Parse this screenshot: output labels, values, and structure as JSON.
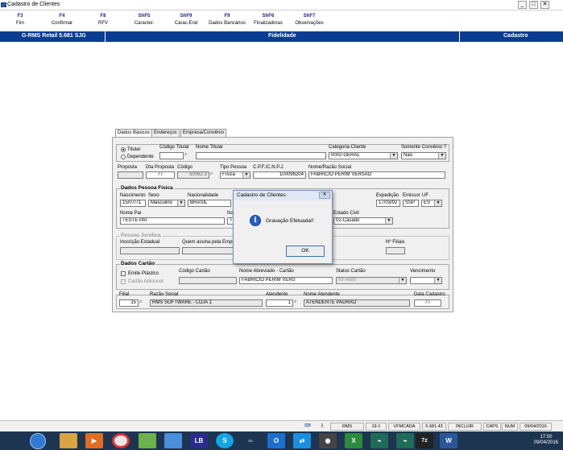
{
  "window": {
    "title": "Cadastro de Clientes",
    "minimize": "_",
    "maximize": "□",
    "close": "✕"
  },
  "function_keys": [
    {
      "key": "F3",
      "label": "Fim"
    },
    {
      "key": "F4",
      "label": "Confirmar"
    },
    {
      "key": "F8",
      "label": "RFV"
    },
    {
      "key": "ShF5",
      "label": "Caracter."
    },
    {
      "key": "ShF9",
      "label": "Carac.End"
    },
    {
      "key": "F9",
      "label": "Dados Bancários"
    },
    {
      "key": "ShF6",
      "label": "Finalizadoras"
    },
    {
      "key": "ShF7",
      "label": "Observações"
    }
  ],
  "header": {
    "app": "G-RMS Retail 5.681 SJG",
    "module": "Fidelidade",
    "screen": "Cadastro"
  },
  "tabs": [
    "Dados Básicos",
    "Endereços",
    "Empresa/Convênio"
  ],
  "form": {
    "tipo_titular": "Titular",
    "tipo_dependente": "Dependente",
    "codigo_titular_label": "Código Titular",
    "nome_titular_label": "Nome Titular",
    "categoria_label": "Categoria Cliente",
    "categoria_value": "0002-GERAL",
    "somente_convenio_label": "Somente Convênio ?",
    "somente_convenio_value": "Não",
    "proposta_label": "Proposta",
    "dta_proposta_label": "Dta Proposta",
    "dta_proposta_value": "/ /",
    "codigo_label": "Código",
    "codigo_value": "50062-3",
    "tipo_pessoa_label": "Tipo Pessoa",
    "tipo_pessoa_value": "Física",
    "cpf_label": "C.P.F./C.N.P.J.",
    "cpf_value": "100096204",
    "nome_label": "Nome/Razão Social",
    "nome_value": "FABRICIO PERIM VERSAO",
    "pf_title": "Dados Pessoa Física",
    "nascimento_label": "Nascimento",
    "nascimento_value": "15/07/71",
    "sexo_label": "Sexo",
    "sexo_value": "Masculino",
    "nacionalidade_label": "Nacionalidade",
    "nacionalidade_value": "BRASIL",
    "expedicao_label": "Expedição",
    "expedicao_value": "17/03/92",
    "emissor_label": "Emissor",
    "emissor_value": "SSP",
    "uf_label": "UF",
    "uf_value": "ES",
    "nome_pai_label": "Nome Pai",
    "nome_pai_value": "TESTE PAI",
    "nome_mae_label_partial": "No",
    "nome_mae_value_partial": "TE",
    "estado_civil_label": "Estado Civil",
    "estado_civil_value": "02-Casado",
    "pj_title": "Pessoa Jurídica",
    "inscricao_label": "Inscrição Estadual",
    "quem_assina_label": "Quem assina pela Empre",
    "nr_filiais_label": "Nº Filiais",
    "cartao_title": "Dados Cartão",
    "emite_plastico": "Emite Plástico",
    "cartao_adicional": "Cartão Adicional",
    "codigo_cartao_label": "Código Cartão",
    "nome_abreviado_label": "Nome Abreviado - Cartão",
    "nome_abreviado_value": "FABRICIO PERIM VERS",
    "status_cartao_label": "Status Cartão",
    "status_cartao_value": "00-Ativo",
    "vencimento_label": "Vencimento",
    "filial_label": "Filial",
    "filial_value": "15",
    "razao_label": "Razão Social",
    "razao_value": "RMS SOFTWARE - LOJA 1",
    "atendente_label": "Atendente",
    "atendente_value": "1",
    "nome_atendente_label": "Nome Atendente",
    "nome_atendente_value": "ATENDENTE PADRAO",
    "data_cadastro_label": "Data Cadastro",
    "data_cadastro_value": "/ /"
  },
  "dialog": {
    "title": "Cadastro de Clientes",
    "message": "Gravação Efetuada!!",
    "ok": "OK",
    "close": "✕",
    "icon": "i"
  },
  "status": [
    "RMS",
    "19-1",
    "VFMCADA",
    "5.681.43",
    "INCLUIR",
    "CAPS",
    "NUM",
    "09/04/2016"
  ],
  "clock": {
    "time": "17:00",
    "date": "09/04/2016"
  },
  "taskbar_icons": [
    "internet-explorer",
    "file-explorer",
    "media-player",
    "chrome",
    "app",
    "chat",
    "lb",
    "skype",
    "link",
    "outlook",
    "teamviewer",
    "disc",
    "excel",
    "terminal",
    "terminal2",
    "7zip",
    "word"
  ],
  "taskbar_labels": {
    "lb": "LB",
    "7zip": "7z",
    "word": "W",
    "outlook": "O",
    "excel": "X",
    "skype": "S"
  }
}
